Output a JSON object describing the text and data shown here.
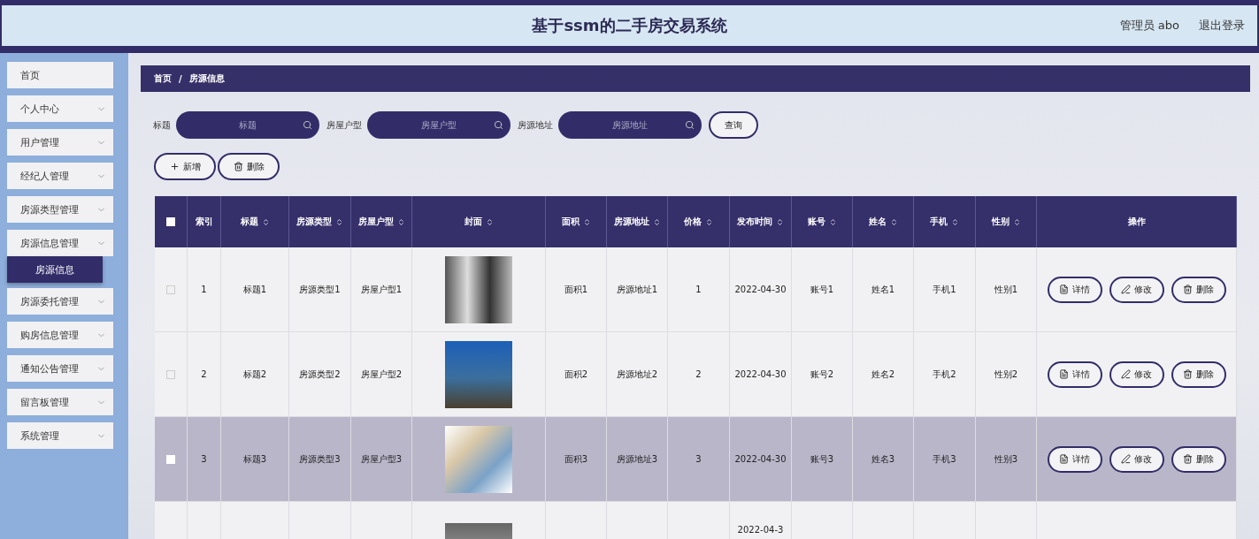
{
  "header": {
    "title": "基于ssm的二手房交易系统",
    "user": "管理员 abo",
    "logout": "退出登录"
  },
  "sidebar": {
    "items": [
      {
        "label": "首页",
        "expandable": false
      },
      {
        "label": "个人中心",
        "expandable": true
      },
      {
        "label": "用户管理",
        "expandable": true
      },
      {
        "label": "经纪人管理",
        "expandable": true
      },
      {
        "label": "房源类型管理",
        "expandable": true
      },
      {
        "label": "房源信息管理",
        "expandable": true,
        "children": [
          {
            "label": "房源信息",
            "selected": true
          }
        ]
      },
      {
        "label": "房源委托管理",
        "expandable": true
      },
      {
        "label": "购房信息管理",
        "expandable": true
      },
      {
        "label": "通知公告管理",
        "expandable": true
      },
      {
        "label": "留言板管理",
        "expandable": true
      },
      {
        "label": "系统管理",
        "expandable": true
      }
    ]
  },
  "breadcrumb": [
    "首页",
    "房源信息"
  ],
  "breadcrumb_separator": "/",
  "filters": [
    {
      "label": "标题",
      "placeholder": "标题"
    },
    {
      "label": "房屋户型",
      "placeholder": "房屋户型"
    },
    {
      "label": "房源地址",
      "placeholder": "房源地址"
    }
  ],
  "search_button": "查询",
  "toolbar": [
    {
      "kind": "add",
      "label": "新增"
    },
    {
      "kind": "delete",
      "label": "删除"
    }
  ],
  "table": {
    "all_checked": false,
    "columns": [
      {
        "label": "索引",
        "sortable": false
      },
      {
        "label": "标题",
        "sortable": true
      },
      {
        "label": "房源类型",
        "sortable": true
      },
      {
        "label": "房屋户型",
        "sortable": true
      },
      {
        "label": "封面",
        "sortable": true
      },
      {
        "label": "面积",
        "sortable": true
      },
      {
        "label": "房源地址",
        "sortable": true
      },
      {
        "label": "价格",
        "sortable": true
      },
      {
        "label": "发布时间",
        "sortable": true
      },
      {
        "label": "账号",
        "sortable": true
      },
      {
        "label": "姓名",
        "sortable": true
      },
      {
        "label": "手机",
        "sortable": true
      },
      {
        "label": "性别",
        "sortable": true
      },
      {
        "label": "操作",
        "sortable": false
      }
    ],
    "rows": [
      {
        "highlighted": false,
        "checked": false,
        "cells": [
          "1",
          "标题1",
          "房源类型1",
          "房屋户型1",
          "",
          "面积1",
          "房源地址1",
          "1",
          "2022-04-30",
          "账号1",
          "姓名1",
          "手机1",
          "性别1"
        ],
        "actions": [
          {
            "kind": "detail",
            "label": "详情"
          },
          {
            "kind": "edit",
            "label": "修改"
          },
          {
            "kind": "delete",
            "label": "删除"
          }
        ]
      },
      {
        "highlighted": false,
        "checked": false,
        "cells": [
          "2",
          "标题2",
          "房源类型2",
          "房屋户型2",
          "",
          "面积2",
          "房源地址2",
          "2",
          "2022-04-30",
          "账号2",
          "姓名2",
          "手机2",
          "性别2"
        ],
        "actions": [
          {
            "kind": "detail",
            "label": "详情"
          },
          {
            "kind": "edit",
            "label": "修改"
          },
          {
            "kind": "delete",
            "label": "删除"
          }
        ]
      },
      {
        "highlighted": true,
        "checked": false,
        "cells": [
          "3",
          "标题3",
          "房源类型3",
          "房屋户型3",
          "",
          "面积3",
          "房源地址3",
          "3",
          "2022-04-30",
          "账号3",
          "姓名3",
          "手机3",
          "性别3"
        ],
        "actions": [
          {
            "kind": "detail",
            "label": "详情"
          },
          {
            "kind": "edit",
            "label": "修改"
          },
          {
            "kind": "delete",
            "label": "删除"
          }
        ]
      },
      {
        "highlighted": false,
        "cells": [
          "",
          "",
          "",
          "",
          "",
          "",
          "",
          "",
          "2022-04-3",
          "",
          "",
          "",
          ""
        ]
      }
    ]
  }
}
